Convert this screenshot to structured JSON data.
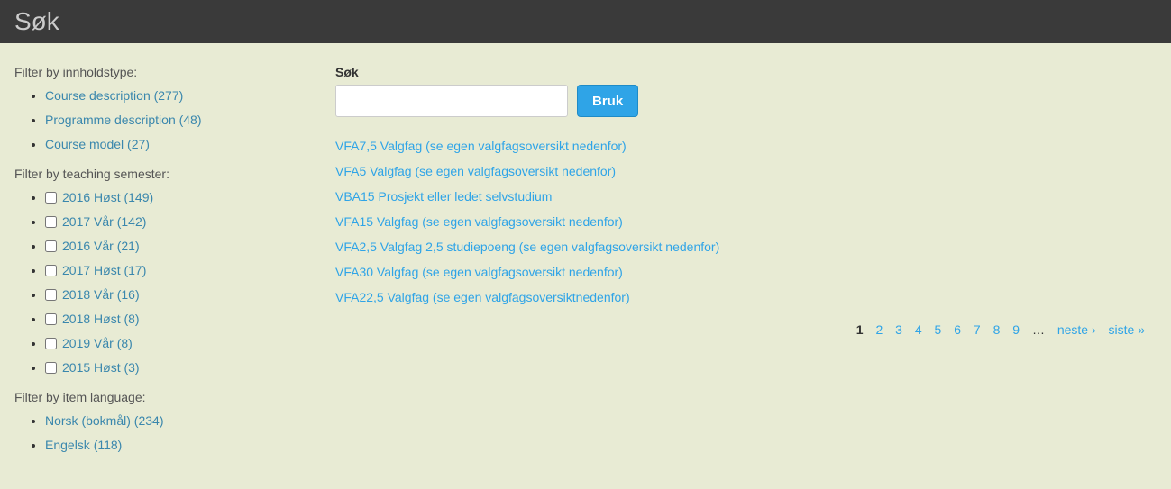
{
  "header": {
    "title": "Søk"
  },
  "sidebar": {
    "content_type": {
      "heading": "Filter by innholdstype:",
      "items": [
        "Course description (277)",
        "Programme description (48)",
        "Course model (27)"
      ]
    },
    "semester": {
      "heading": "Filter by teaching semester:",
      "items": [
        "2016 Høst (149)",
        "2017 Vår (142)",
        "2016 Vår (21)",
        "2017 Høst (17)",
        "2018 Vår (16)",
        "2018 Høst (8)",
        "2019 Vår (8)",
        "2015 Høst (3)"
      ]
    },
    "language": {
      "heading": "Filter by item language:",
      "items": [
        "Norsk (bokmål) (234)",
        "Engelsk (118)"
      ]
    }
  },
  "main": {
    "search_label": "Søk",
    "search_value": "",
    "submit_label": "Bruk",
    "results": [
      "VFA7,5 Valgfag (se egen valgfagsoversikt nedenfor)",
      "VFA5 Valgfag (se egen valgfagsoversikt nedenfor)",
      "VBA15 Prosjekt eller ledet selvstudium",
      "VFA15 Valgfag (se egen valgfagsoversikt nedenfor)",
      "VFA2,5 Valgfag 2,5 studiepoeng (se egen valgfagsoversikt nedenfor)",
      "VFA30 Valgfag (se egen valgfagsoversikt nedenfor)",
      "VFA22,5 Valgfag (se egen valgfagsoversiktnedenfor)"
    ],
    "pagination": {
      "pages": [
        "1",
        "2",
        "3",
        "4",
        "5",
        "6",
        "7",
        "8",
        "9"
      ],
      "ellipsis": "…",
      "next": "neste ›",
      "last": "siste »",
      "current": "1"
    }
  }
}
